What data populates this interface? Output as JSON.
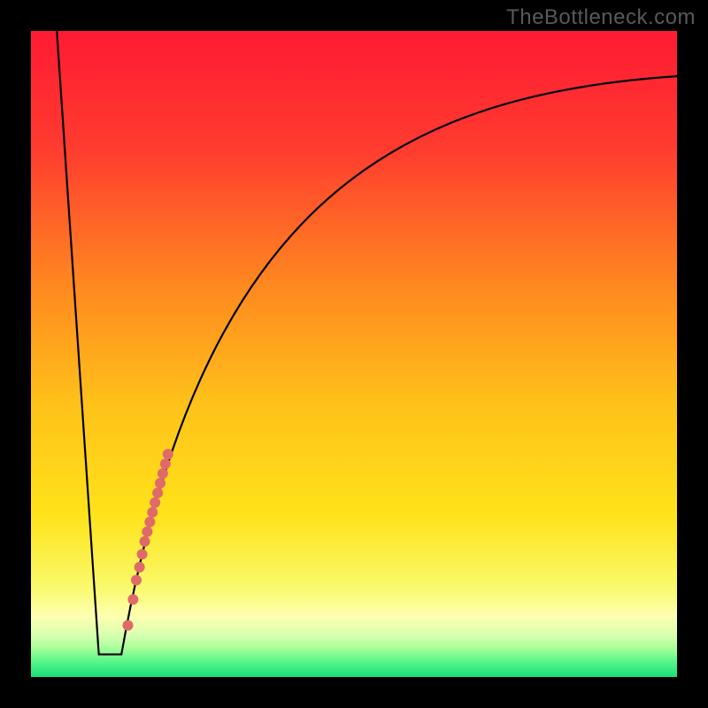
{
  "watermark": "TheBottleneck.com",
  "chart_data": {
    "type": "line",
    "title": "",
    "xlabel": "",
    "ylabel": "",
    "xlim": [
      0,
      100
    ],
    "ylim": [
      0,
      100
    ],
    "optimum_x": 12.5,
    "curve": {
      "left_start": {
        "x": 4,
        "y": 100
      },
      "valley_left_x": 10.5,
      "valley_right_x": 14,
      "valley_y": 3.5,
      "right_end": {
        "x": 100,
        "y": 93
      },
      "right_ctrl1": {
        "x": 26,
        "y": 72
      },
      "right_ctrl2": {
        "x": 55,
        "y": 90
      }
    },
    "dots": [
      {
        "x": 15.0,
        "y": 8
      },
      {
        "x": 15.8,
        "y": 12
      },
      {
        "x": 16.3,
        "y": 15
      },
      {
        "x": 16.8,
        "y": 17
      },
      {
        "x": 17.2,
        "y": 19
      },
      {
        "x": 17.6,
        "y": 21
      },
      {
        "x": 18.0,
        "y": 22.5
      },
      {
        "x": 18.4,
        "y": 24
      },
      {
        "x": 18.8,
        "y": 25.5
      },
      {
        "x": 19.2,
        "y": 27
      },
      {
        "x": 19.6,
        "y": 28.5
      },
      {
        "x": 20.0,
        "y": 30
      },
      {
        "x": 20.4,
        "y": 31.5
      },
      {
        "x": 20.8,
        "y": 33
      },
      {
        "x": 21.2,
        "y": 34.5
      }
    ],
    "dot_color": "#e06a6a",
    "dot_radius": 6,
    "gradient_stops": [
      {
        "offset": 0.0,
        "color": "#ff1a33"
      },
      {
        "offset": 0.18,
        "color": "#ff3b2f"
      },
      {
        "offset": 0.4,
        "color": "#ff8a1f"
      },
      {
        "offset": 0.58,
        "color": "#ffc21a"
      },
      {
        "offset": 0.75,
        "color": "#ffe31a"
      },
      {
        "offset": 0.86,
        "color": "#f9f96a"
      },
      {
        "offset": 0.905,
        "color": "#ffffb0"
      },
      {
        "offset": 0.935,
        "color": "#d9ffb0"
      },
      {
        "offset": 0.955,
        "color": "#a8ff9a"
      },
      {
        "offset": 0.975,
        "color": "#5cf78a"
      },
      {
        "offset": 1.0,
        "color": "#18e07a"
      }
    ]
  }
}
